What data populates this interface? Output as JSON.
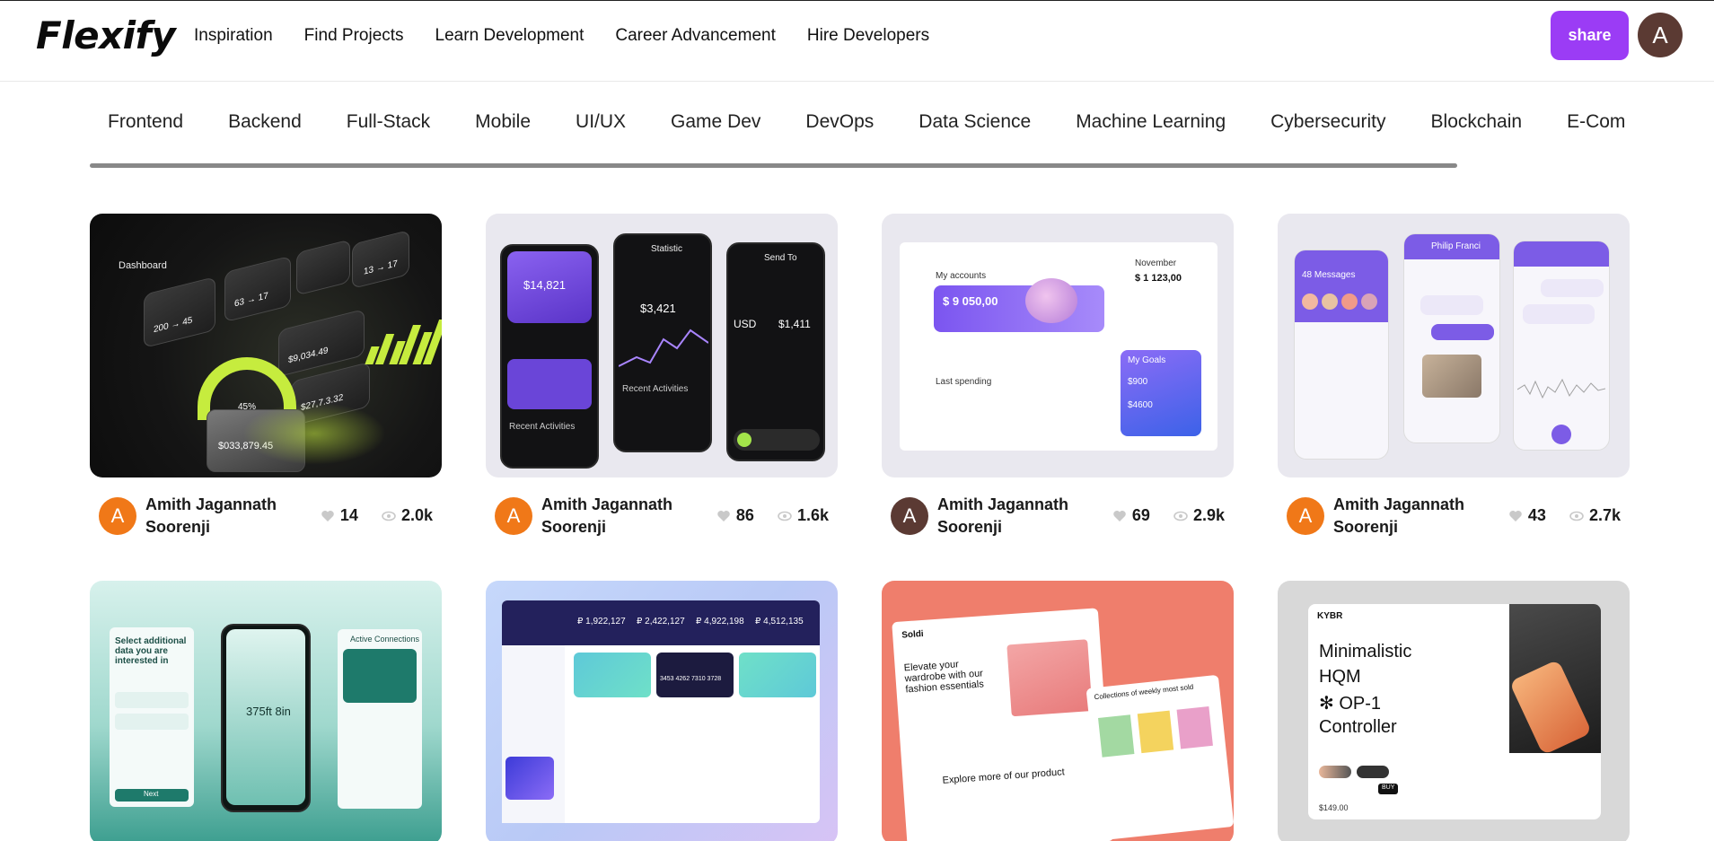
{
  "app": {
    "logo": "Flexify",
    "nav": [
      "Inspiration",
      "Find Projects",
      "Learn Development",
      "Career Advancement",
      "Hire Developers"
    ],
    "share_label": "share",
    "avatar_letter": "A",
    "colors": {
      "accent": "#9b3cf5",
      "avatar_brown": "#5b3a33",
      "avatar_orange": "#f07818"
    }
  },
  "categories": [
    "Frontend",
    "Backend",
    "Full-Stack",
    "Mobile",
    "UI/UX",
    "Game Dev",
    "DevOps",
    "Data Science",
    "Machine Learning",
    "Cybersecurity",
    "Blockchain",
    "E-Com"
  ],
  "cards": [
    {
      "author": "Amith Jagannath Soorenji",
      "avatar_letter": "A",
      "avatar_color": "#f07818",
      "likes": "14",
      "views": "2.0k"
    },
    {
      "author": "Amith Jagannath Soorenji",
      "avatar_letter": "A",
      "avatar_color": "#f07818",
      "likes": "86",
      "views": "1.6k"
    },
    {
      "author": "Amith Jagannath Soorenji",
      "avatar_letter": "A",
      "avatar_color": "#5b3a33",
      "likes": "69",
      "views": "2.9k"
    },
    {
      "author": "Amith Jagannath Soorenji",
      "avatar_letter": "A",
      "avatar_color": "#f07818",
      "likes": "43",
      "views": "2.7k"
    }
  ],
  "thumb_text": {
    "t1": {
      "pct": "45%",
      "amount": "$033,879.45",
      "tile_a": "200 → 45",
      "tile_b": "63 → 17",
      "tile_c": "13 → 17",
      "tile_d": "$9,034.49",
      "tile_e": "$27,7.3.32",
      "dash": "Dashboard"
    },
    "t2": {
      "bal1": "$14,821",
      "bal2": "$3,421",
      "usd": "USD",
      "usd_val": "$1,411",
      "recent": "Recent Activities",
      "send": "Send To",
      "stmt": "Statistic"
    },
    "t3": {
      "acc_label": "My accounts",
      "acc_val": "$ 9 050,00",
      "month": "November",
      "budget": "$ 1 123,00",
      "last": "Last spending",
      "goals": "My Goals",
      "g1": "$900",
      "g2": "$4600"
    },
    "t4": {
      "msgs": "48 Messages",
      "profile": "Philip Franci"
    },
    "t5": {
      "select": "Select additional data you are interested in",
      "time": "375ft 8in",
      "active": "Active Connections",
      "btn": "Next"
    },
    "t6": {
      "v1": "₽ 1,922,127",
      "v2": "₽ 2,422,127",
      "v3": "₽ 4,922,198",
      "v4": "₽ 4,512,135",
      "card": "3453 4262 7310 3728"
    },
    "t7": {
      "headline": "Elevate your wardrobe with our fashion essentials",
      "explore": "Explore more of our product",
      "weekly": "Collections of weekly most sold",
      "brand": "Soldi"
    },
    "t8": {
      "l1": "Minimalistic",
      "l2": "HQM",
      "l3": "✻ OP-1",
      "l4": "Controller",
      "brand": "KYBR",
      "price": "$149.00",
      "btn": "BUY"
    }
  }
}
